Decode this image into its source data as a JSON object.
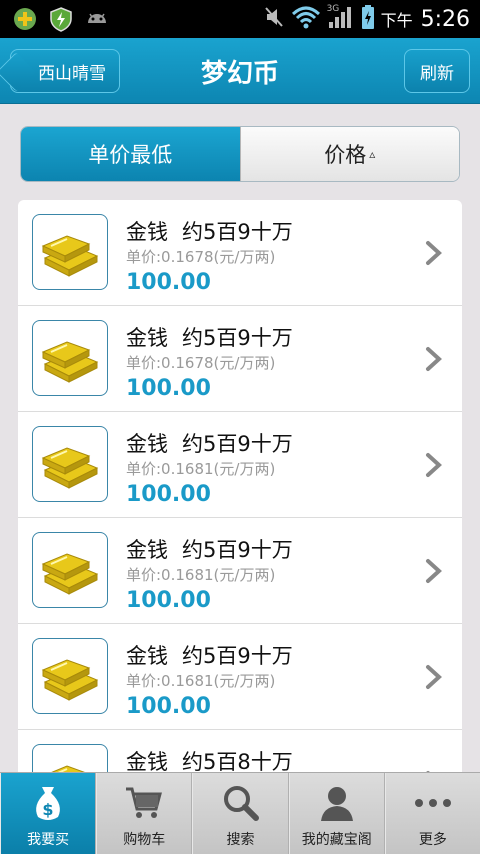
{
  "status_bar": {
    "ampm": "下午",
    "time": "5:26",
    "network": "3G"
  },
  "header": {
    "back_label": "西山晴雪",
    "title": "梦幻币",
    "refresh_label": "刷新"
  },
  "tabs": [
    {
      "label": "单价最低",
      "active": true
    },
    {
      "label": "价格",
      "sort_indicator": "▵",
      "active": false
    }
  ],
  "items": [
    {
      "name": "金钱",
      "amount": "约5百9十万",
      "unit_price": "单价:0.1678(元/万两)",
      "price": "100.00"
    },
    {
      "name": "金钱",
      "amount": "约5百9十万",
      "unit_price": "单价:0.1678(元/万两)",
      "price": "100.00"
    },
    {
      "name": "金钱",
      "amount": "约5百9十万",
      "unit_price": "单价:0.1681(元/万两)",
      "price": "100.00"
    },
    {
      "name": "金钱",
      "amount": "约5百9十万",
      "unit_price": "单价:0.1681(元/万两)",
      "price": "100.00"
    },
    {
      "name": "金钱",
      "amount": "约5百9十万",
      "unit_price": "单价:0.1681(元/万两)",
      "price": "100.00"
    },
    {
      "name": "金钱",
      "amount": "约5百8十万",
      "unit_price": "",
      "price": ""
    }
  ],
  "bottom_nav": [
    {
      "label": "我要买",
      "icon": "money-bag-icon",
      "active": true
    },
    {
      "label": "购物车",
      "icon": "cart-icon",
      "active": false
    },
    {
      "label": "搜索",
      "icon": "search-icon",
      "active": false
    },
    {
      "label": "我的藏宝阁",
      "icon": "user-icon",
      "active": false
    },
    {
      "label": "更多",
      "icon": "more-icon",
      "active": false
    }
  ],
  "colors": {
    "accent": "#1aa3cf",
    "price": "#1a9ac8"
  }
}
